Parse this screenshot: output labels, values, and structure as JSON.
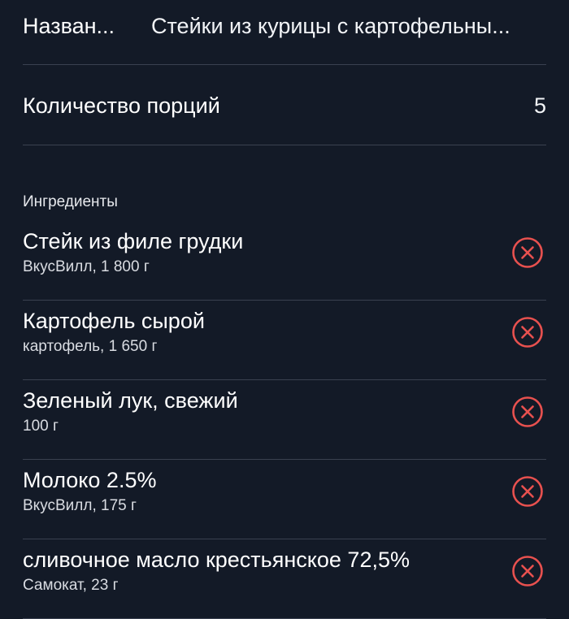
{
  "recipe": {
    "name_label": "Назван...",
    "name_value": "Стейки из курицы с картофельны...",
    "portions_label": "Количество порций",
    "portions_value": "5"
  },
  "ingredients_section": {
    "title": "Ингредиенты",
    "items": [
      {
        "name": "Стейк из филе грудки",
        "detail": "ВкусВилл, 1 800 г"
      },
      {
        "name": "Картофель сырой",
        "detail": "картофель, 1 650 г"
      },
      {
        "name": "Зеленый лук, свежий",
        "detail": "100 г"
      },
      {
        "name": "Молоко 2.5%",
        "detail": "ВкусВилл, 175 г"
      },
      {
        "name": "сливочное масло крестьянское 72,5%",
        "detail": "Самокат, 23 г"
      }
    ],
    "remove_icon": "circle-x-icon"
  },
  "colors": {
    "background": "#131a27",
    "divider": "#3a4150",
    "remove_accent": "#e8514f"
  }
}
